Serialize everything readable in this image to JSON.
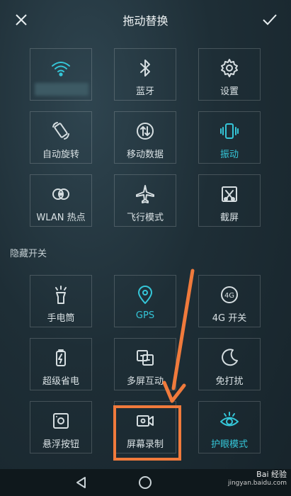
{
  "header": {
    "title": "拖动替换"
  },
  "section": {
    "hidden_title": "隐藏开关"
  },
  "tiles": [
    {
      "label": "",
      "icon": "wifi-icon",
      "active": true
    },
    {
      "label": "蓝牙",
      "icon": "bluetooth-icon",
      "active": false
    },
    {
      "label": "设置",
      "icon": "gear-icon",
      "active": false
    },
    {
      "label": "自动旋转",
      "icon": "rotate-icon",
      "active": false
    },
    {
      "label": "移动数据",
      "icon": "data-icon",
      "active": false
    },
    {
      "label": "振动",
      "icon": "vibrate-icon",
      "active": true
    },
    {
      "label": "WLAN 热点",
      "icon": "hotspot-icon",
      "active": false
    },
    {
      "label": "飞行模式",
      "icon": "airplane-icon",
      "active": false
    },
    {
      "label": "截屏",
      "icon": "screenshot-icon",
      "active": false
    }
  ],
  "hidden_tiles": [
    {
      "label": "手电筒",
      "icon": "flashlight-icon",
      "active": false
    },
    {
      "label": "GPS",
      "icon": "location-icon",
      "active": true
    },
    {
      "label": "4G 开关",
      "icon": "4g-icon",
      "active": false
    },
    {
      "label": "超级省电",
      "icon": "battery-icon",
      "active": false
    },
    {
      "label": "多屏互动",
      "icon": "multiscreen-icon",
      "active": false
    },
    {
      "label": "免打扰",
      "icon": "moon-icon",
      "active": false
    },
    {
      "label": "悬浮按钮",
      "icon": "float-button-icon",
      "active": false
    },
    {
      "label": "屏幕录制",
      "icon": "screen-record-icon",
      "active": false
    },
    {
      "label": "护眼模式",
      "icon": "eye-icon",
      "active": true
    }
  ],
  "watermark": {
    "text": "Bai 经验",
    "sub": "jingyan.baidu.com"
  },
  "colors": {
    "accent": "#35c6d8",
    "highlight": "#f07a3c",
    "icon": "#d6dee1"
  }
}
